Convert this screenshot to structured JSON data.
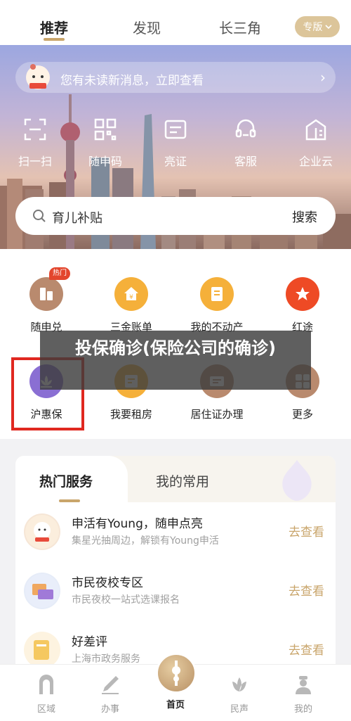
{
  "top_tabs": {
    "items": [
      {
        "label": "推荐",
        "active": true
      },
      {
        "label": "发现",
        "active": false
      },
      {
        "label": "长三角",
        "active": false
      }
    ],
    "edition_label": "专版",
    "edition_icon": "chevron-down-icon"
  },
  "hero": {
    "message": "您有未读新消息，立即查看",
    "message_arrow": "›",
    "quick_actions": [
      {
        "label": "扫一扫",
        "icon": "scan-icon"
      },
      {
        "label": "随申码",
        "icon": "qr-code-icon"
      },
      {
        "label": "亮证",
        "icon": "id-card-icon"
      },
      {
        "label": "客服",
        "icon": "headset-icon"
      },
      {
        "label": "企业云",
        "icon": "building-icon"
      }
    ],
    "search_placeholder": "育儿补贴",
    "search_button": "搜索"
  },
  "services": {
    "items": [
      {
        "label": "随申兑",
        "icon": "redeem-icon",
        "color": "#b98a6e",
        "badge": "热门"
      },
      {
        "label": "三金账单",
        "icon": "house-yuan-icon",
        "color": "#f5b03a"
      },
      {
        "label": "我的不动产",
        "icon": "property-cert-icon",
        "color": "#f5b03a"
      },
      {
        "label": "红途",
        "icon": "red-star-icon",
        "color": "#ee4a25"
      },
      {
        "label": "沪惠保",
        "icon": "lotus-icon",
        "color": "#8a6fd3"
      },
      {
        "label": "我要租房",
        "icon": "rent-house-icon",
        "color": "#f5b03a"
      },
      {
        "label": "居住证办理",
        "icon": "residence-card-icon",
        "color": "#b98a6e"
      },
      {
        "label": "更多",
        "icon": "grid-more-icon",
        "color": "#b98a6e"
      }
    ]
  },
  "overlay": {
    "title": "投保确诊(保险公司的确诊)"
  },
  "hot_card": {
    "tab_active": "热门服务",
    "tab_inactive": "我的常用",
    "rows": [
      {
        "title": "申活有Young，随申点亮",
        "subtitle": "集星光抽周边，解锁有Young申活",
        "action": "去查看"
      },
      {
        "title": "市民夜校专区",
        "subtitle": "市民夜校一站式选课报名",
        "action": "去查看"
      },
      {
        "title": "好差评",
        "subtitle": "上海市政务服务",
        "action": "去查看"
      }
    ]
  },
  "bottom_nav": {
    "items": [
      {
        "label": "区域",
        "icon": "gate-icon"
      },
      {
        "label": "办事",
        "icon": "pen-icon"
      },
      {
        "label": "首页",
        "icon": "home-tower-icon",
        "active": true
      },
      {
        "label": "民声",
        "icon": "magnolia-icon"
      },
      {
        "label": "我的",
        "icon": "user-icon"
      }
    ]
  },
  "colors": {
    "accent": "#c9a56b",
    "highlight": "#e02820"
  }
}
